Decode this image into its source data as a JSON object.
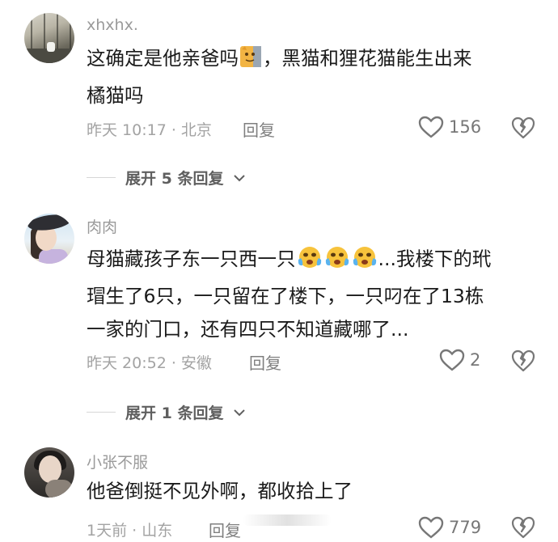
{
  "comments": [
    {
      "username": "xhxhx.",
      "text_line1_a": "这确定是他亲爸吗",
      "text_line1_b": "，黑猫和狸花猫能生出来",
      "text_line2": "橘猫吗",
      "meta": "昨天 10:17 · 北京",
      "reply_label": "回复",
      "likes": "156",
      "expand_label": "展开 5 条回复"
    },
    {
      "username": "肉肉",
      "text_line1_a": "母猫藏孩子东一只西一只",
      "text_line1_b": "...我楼下的玳",
      "text_line2": "瑁生了6只，一只留在了楼下，一只叼在了13栋",
      "text_line3": "一家的门口，还有四只不知道藏哪了...",
      "meta": "昨天 20:52 · 安徽",
      "reply_label": "回复",
      "likes": "2",
      "expand_label": "展开 1 条回复"
    },
    {
      "username": "小张不服",
      "text_line1": "他爸倒挺不见外啊，都收拾上了",
      "meta": "1天前 · 山东",
      "reply_label": "回复",
      "likes": "779"
    }
  ],
  "icons": {
    "like": "heart-outline-icon",
    "dislike": "broken-heart-icon",
    "expand": "chevron-down-icon",
    "emoji_cat": "cat-emoji",
    "emoji_cry": "crying-face-emoji"
  },
  "colors": {
    "text": "#1a1a1a",
    "meta": "#a3a3a3",
    "username": "#9a9a9a"
  }
}
